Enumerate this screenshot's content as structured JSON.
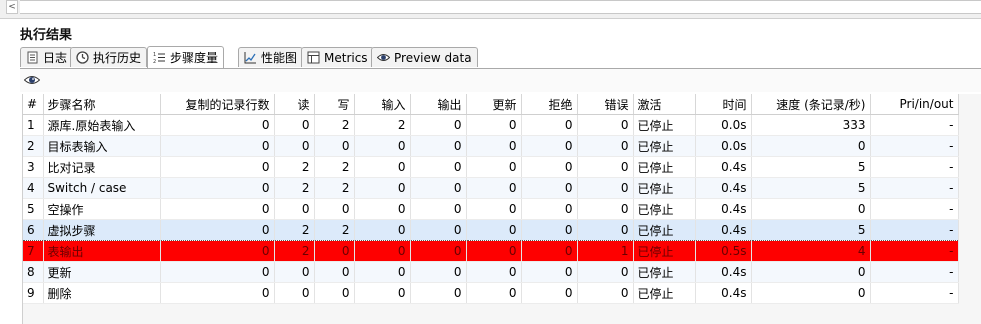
{
  "panel": {
    "title": "执行结果"
  },
  "nav": {
    "scroll_left_glyph": "<"
  },
  "tabs": [
    {
      "label": "日志",
      "icon": "log-icon"
    },
    {
      "label": "执行历史",
      "icon": "history-icon"
    },
    {
      "label": "步骤度量",
      "icon": "step-metrics-icon",
      "active": true
    },
    {
      "label": "性能图",
      "icon": "performance-chart-icon"
    },
    {
      "label": "Metrics",
      "icon": "metrics-icon"
    },
    {
      "label": "Preview data",
      "icon": "preview-eye-icon"
    }
  ],
  "toolbar": {
    "icon": "eye-icon"
  },
  "colors": {
    "error_row": "#fe0000",
    "selected_row": "#dceafa",
    "stripe_row": "#f4f8fd"
  },
  "table": {
    "columns": [
      "#",
      "步骤名称",
      "复制的记录行数",
      "读",
      "写",
      "输入",
      "输出",
      "更新",
      "拒绝",
      "错误",
      "激活",
      "时间",
      "速度 (条记录/秒)",
      "Pri/in/out"
    ],
    "rows": [
      [
        "1",
        "源库.原始表输入",
        "0",
        "0",
        "2",
        "2",
        "0",
        "0",
        "0",
        "0",
        "已停止",
        "0.0s",
        "333",
        "-"
      ],
      [
        "2",
        "目标表输入",
        "0",
        "0",
        "0",
        "0",
        "0",
        "0",
        "0",
        "0",
        "已停止",
        "0.0s",
        "0",
        "-"
      ],
      [
        "3",
        "比对记录",
        "0",
        "2",
        "2",
        "0",
        "0",
        "0",
        "0",
        "0",
        "已停止",
        "0.4s",
        "5",
        "-"
      ],
      [
        "4",
        "Switch / case",
        "0",
        "2",
        "2",
        "0",
        "0",
        "0",
        "0",
        "0",
        "已停止",
        "0.4s",
        "5",
        "-"
      ],
      [
        "5",
        "空操作",
        "0",
        "0",
        "0",
        "0",
        "0",
        "0",
        "0",
        "0",
        "已停止",
        "0.4s",
        "0",
        "-"
      ],
      [
        "6",
        "虚拟步骤",
        "0",
        "2",
        "2",
        "0",
        "0",
        "0",
        "0",
        "0",
        "已停止",
        "0.4s",
        "5",
        "-"
      ],
      [
        "7",
        "表输出",
        "0",
        "2",
        "0",
        "0",
        "0",
        "0",
        "0",
        "1",
        "已停止",
        "0.5s",
        "4",
        "-"
      ],
      [
        "8",
        "更新",
        "0",
        "0",
        "0",
        "0",
        "0",
        "0",
        "0",
        "0",
        "已停止",
        "0.4s",
        "0",
        "-"
      ],
      [
        "9",
        "删除",
        "0",
        "0",
        "0",
        "0",
        "0",
        "0",
        "0",
        "0",
        "已停止",
        "0.4s",
        "0",
        "-"
      ]
    ]
  }
}
